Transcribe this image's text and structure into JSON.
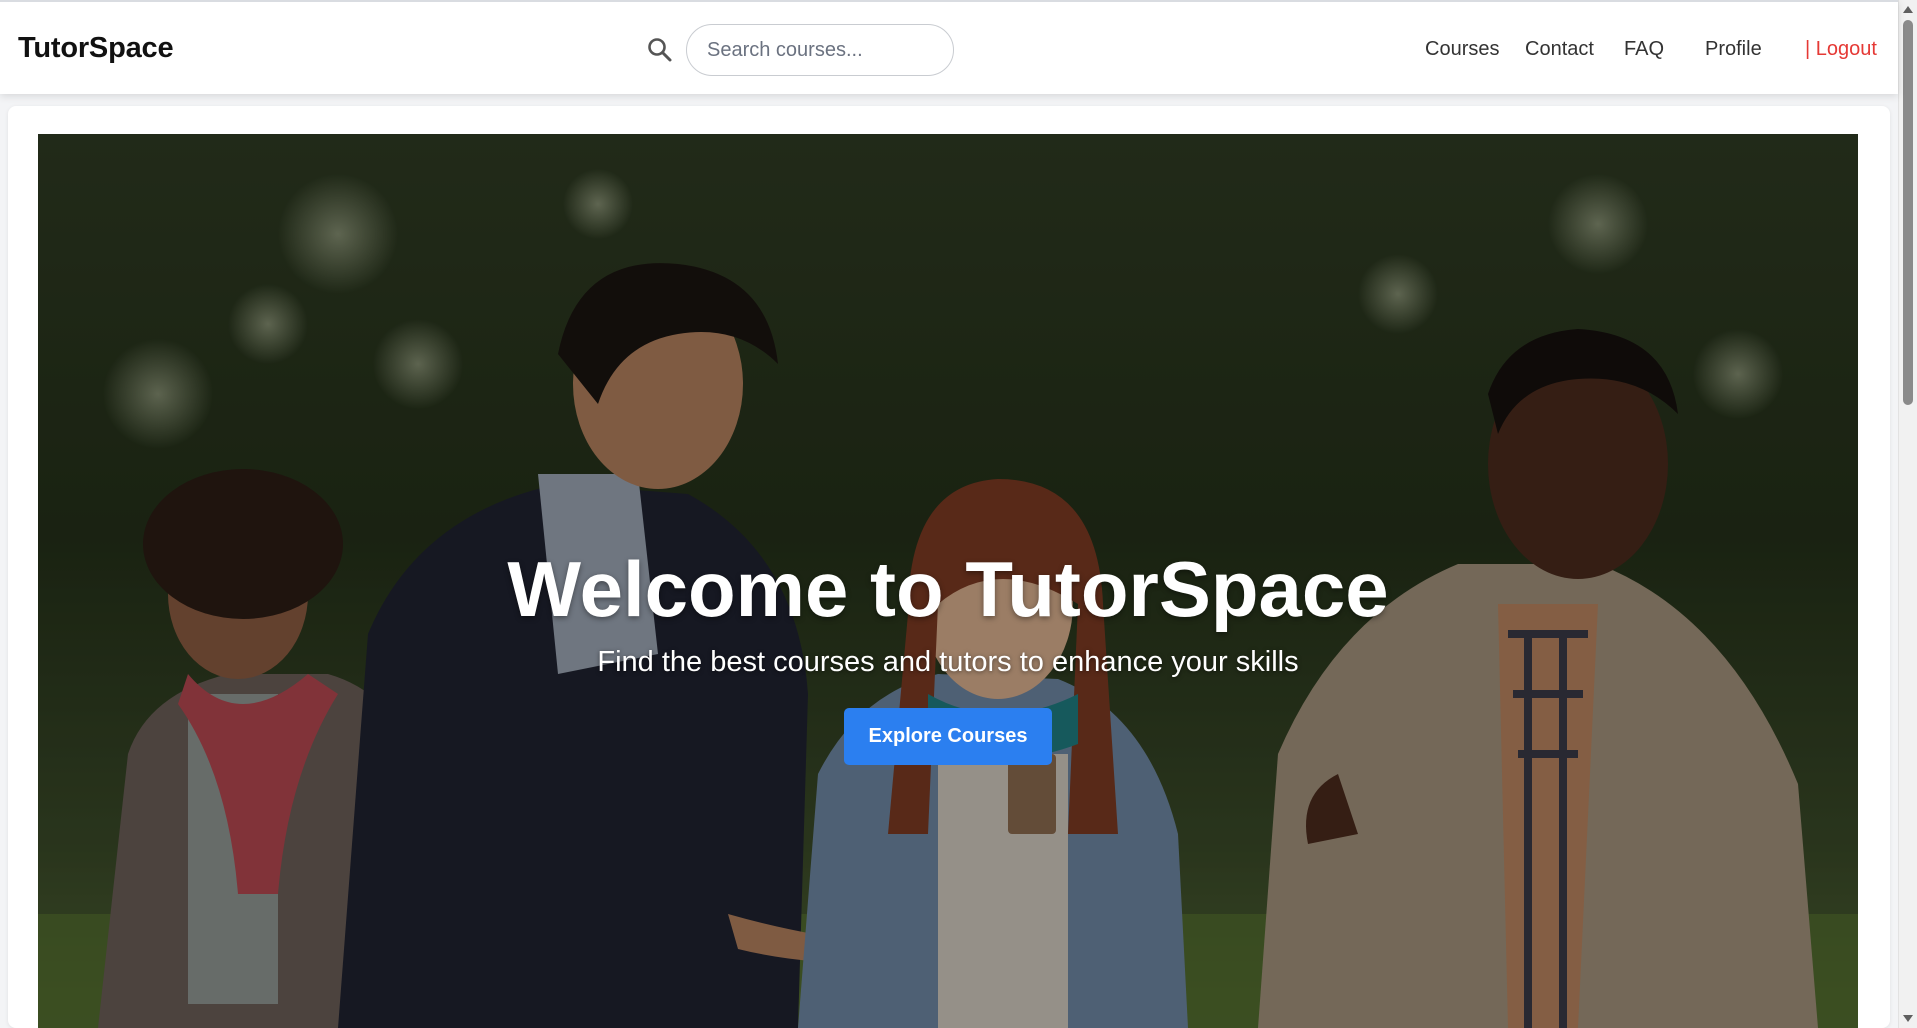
{
  "header": {
    "brand": "TutorSpace",
    "search_icon": "search-icon",
    "search_placeholder": "Search courses...",
    "nav": {
      "courses": "Courses",
      "contact": "Contact",
      "faq": "FAQ",
      "profile": "Profile",
      "logout": "| Logout"
    }
  },
  "hero": {
    "title": "Welcome to TutorSpace",
    "subtitle": "Find the best courses and tutors to enhance your skills",
    "button": "Explore Courses",
    "image": "photo of four smiling students talking outdoors in a park"
  },
  "colors": {
    "accent": "#2b7ff0",
    "logout": "#e53935",
    "text": "#333333"
  }
}
